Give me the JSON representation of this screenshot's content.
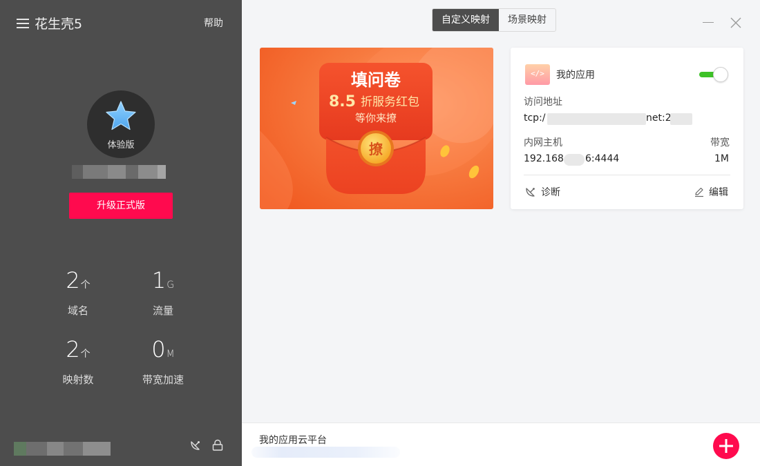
{
  "sidebar": {
    "brand": "花生壳5",
    "help": "帮助",
    "edition": "体验版",
    "upgrade": "升级正式版",
    "stats": [
      {
        "value": "2",
        "unit": "个",
        "label": "域名"
      },
      {
        "value": "1",
        "unit": "G",
        "label": "流量"
      },
      {
        "value": "2",
        "unit": "个",
        "label": "映射数"
      },
      {
        "value": "0",
        "unit": "M",
        "label": "带宽加速"
      }
    ]
  },
  "tabs": [
    {
      "label": "自定义映射",
      "active": true
    },
    {
      "label": "场景映射",
      "active": false
    }
  ],
  "banner": {
    "title": "填问卷",
    "discount": "8.5",
    "offer": "折服务红包",
    "subtitle": "等你来撩",
    "coin": "撩"
  },
  "app": {
    "name": "我的应用",
    "access_label": "访问地址",
    "access_prefix": "tcp:/",
    "access_mid": "net:2",
    "host_label": "内网主机",
    "host_prefix": "192.168.",
    "host_suffix": "6:4444",
    "bw_label": "带宽",
    "bw_value": "1M",
    "diagnose": "诊断",
    "edit": "编辑",
    "enabled": true
  },
  "bottom": {
    "title": "我的应用云平台"
  },
  "colors": {
    "sidebar_bg": "#4d4d4d",
    "accent": "#ff0a4e",
    "toggle_on": "#3dc227",
    "banner_orange": "#f4622a"
  }
}
